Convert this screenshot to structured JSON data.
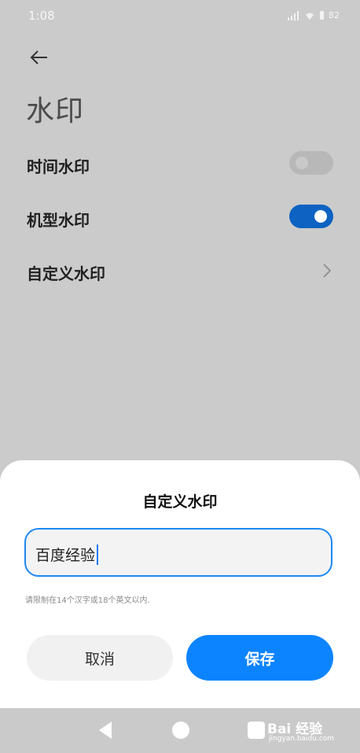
{
  "status": {
    "time": "1:08",
    "battery": "82"
  },
  "page": {
    "title": "水印"
  },
  "rows": [
    {
      "label": "时间水印",
      "toggle": "off"
    },
    {
      "label": "机型水印",
      "toggle": "on"
    },
    {
      "label": "自定义水印"
    }
  ],
  "dialog": {
    "title": "自定义水印",
    "input_value": "百度经验",
    "hint": "请限制在14个汉字或18个英文以内.",
    "cancel_label": "取消",
    "save_label": "保存"
  },
  "watermark": {
    "brand": "Bai 经验",
    "url": "jingyan.baidu.com"
  },
  "colors": {
    "accent": "#0d84ff",
    "toggle_on": "#0e62c2"
  }
}
